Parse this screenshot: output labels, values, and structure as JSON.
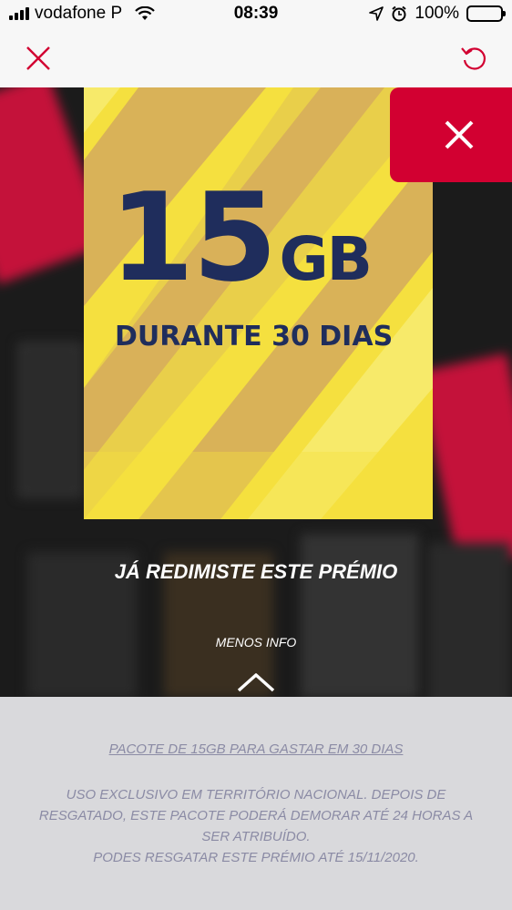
{
  "status_bar": {
    "carrier": "vodafone P",
    "time": "08:39",
    "battery": "100%",
    "icons": [
      "signal-icon",
      "wifi-icon",
      "location-icon",
      "alarm-icon",
      "battery-icon"
    ]
  },
  "toolbar": {
    "close_icon": "close-icon",
    "reload_icon": "reload-icon"
  },
  "prize": {
    "amount": "15",
    "unit": "GB",
    "subtitle": "DURANTE 30 DIAS"
  },
  "modal": {
    "close_icon": "close-icon",
    "redeemed_text": "JÁ REDIMISTE ESTE PRÉMIO",
    "less_info": "MENOS INFO",
    "chevron_icon": "chevron-up-icon"
  },
  "details": {
    "title": "PACOTE DE 15GB PARA GASTAR EM 30 DIAS",
    "lines": [
      "USO EXCLUSIVO EM TERRITÓRIO NACIONAL. DEPOIS DE",
      "RESGATADO, ESTE PACOTE PODERÁ DEMORAR ATÉ 24 HORAS A",
      "SER ATRIBUÍDO.",
      "PODES RESGATAR ESTE PRÉMIO ATÉ 15/11/2020."
    ]
  },
  "colors": {
    "brand_red": "#d20031",
    "card_yellow": "#f5e03f",
    "text_navy": "#1f2d5c",
    "info_text": "#8b8ba5"
  }
}
